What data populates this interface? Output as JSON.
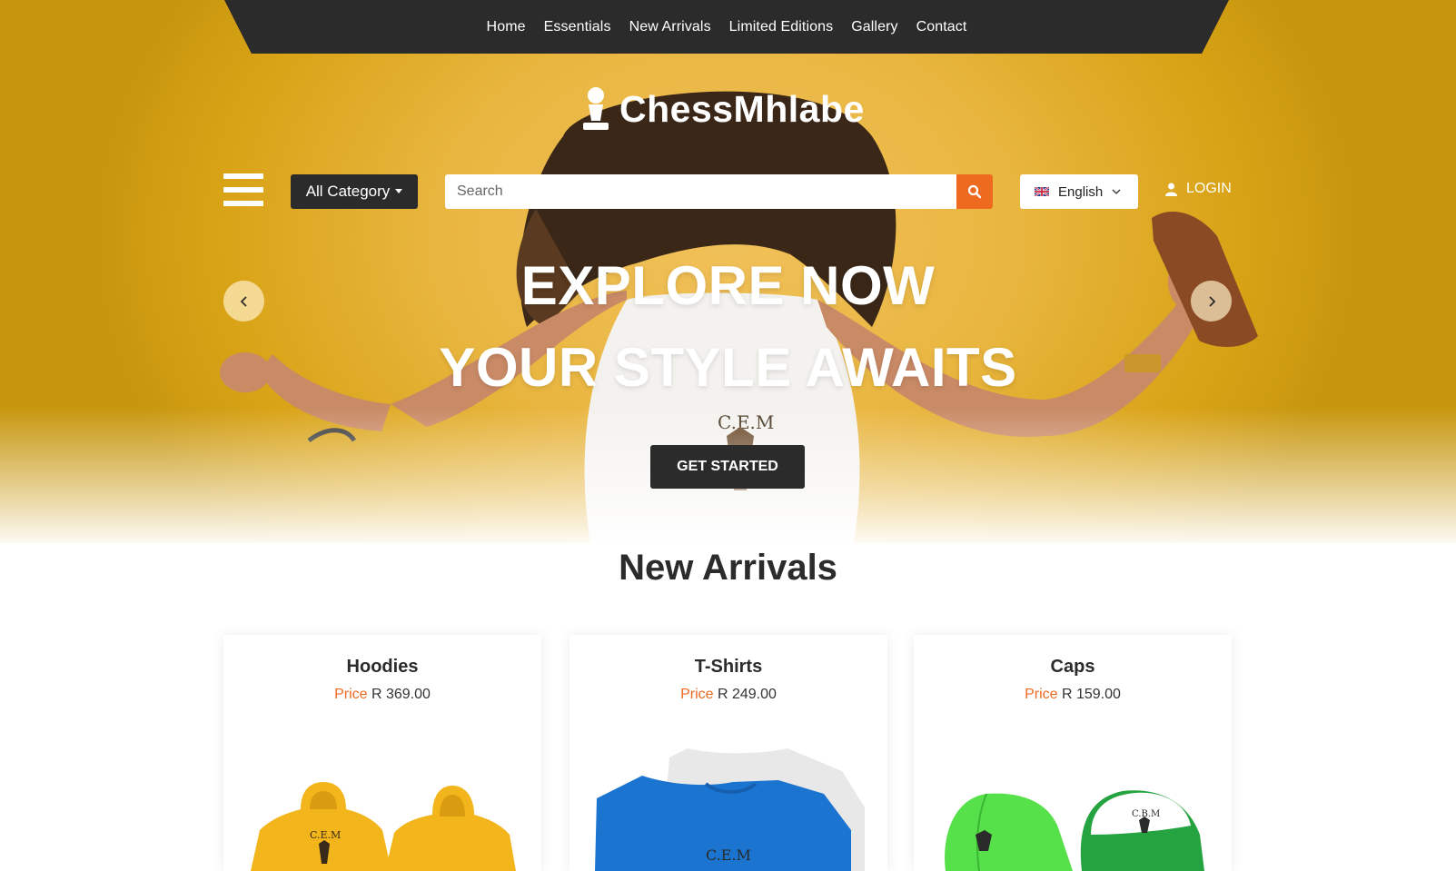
{
  "nav": {
    "items": [
      "Home",
      "Essentials",
      "New Arrivals",
      "Limited Editions",
      "Gallery",
      "Contact"
    ]
  },
  "brand": {
    "name": "ChessMhlabe",
    "icon": "chess-pawn-icon"
  },
  "header": {
    "category_label": "All Category",
    "search_placeholder": "Search",
    "search_value": "",
    "language": "English",
    "login_label": "LOGIN"
  },
  "hero": {
    "line1": "EXPLORE NOW",
    "line2": "YOUR STYLE AWAITS",
    "cta": "GET STARTED"
  },
  "arrivals": {
    "title": "New Arrivals",
    "price_label": "Price",
    "items": [
      {
        "name": "Hoodies",
        "price": "R 369.00"
      },
      {
        "name": "T-Shirts",
        "price": "R 249.00"
      },
      {
        "name": "Caps",
        "price": "R 159.00"
      }
    ]
  },
  "colors": {
    "accent": "#ee6a1e",
    "dark": "#2b2b2b",
    "hero": "#e9b640"
  }
}
